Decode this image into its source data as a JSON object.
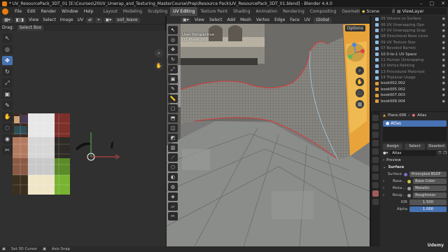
{
  "titlebar": {
    "title": "* UV_ResourcePack_3DT_01 [E:\\Courses\\20UV_Unwrap_and_Texturing_MasterCourse\\Prep\\Resource Pack\\UV_ResourcePack_3DT_01.blend] - Blender 4.4.0"
  },
  "menu": {
    "items": [
      "File",
      "Edit",
      "Render",
      "Window",
      "Help"
    ]
  },
  "workspaces": {
    "tabs": [
      "Layout",
      "Modeling",
      "Sculpting",
      "UV Editing",
      "Texture Paint",
      "Shading",
      "Animation",
      "Rendering",
      "Compositing",
      "Geometry Nodes",
      "Scripting"
    ],
    "active": "UV Editing"
  },
  "scene": {
    "label": "Scene"
  },
  "viewlayer": {
    "label": "ViewLayer"
  },
  "uv": {
    "header": {
      "view": "View",
      "select": "Select",
      "image": "Image",
      "uv": "UV",
      "image_name": "soil_leave"
    },
    "drag_label": "Drag:",
    "select_mode": "Select Box"
  },
  "viewport": {
    "menus": [
      "View",
      "Select",
      "Add",
      "Mesh",
      "Vertex",
      "Edge",
      "Face",
      "UV"
    ],
    "orientation": "Global",
    "options": "Options",
    "info_line1": "User Perspective",
    "info_line2": "(1) Plane.006"
  },
  "outliner": {
    "rows": [
      {
        "label": "05 Volume vs Surface",
        "kind": "col"
      },
      {
        "label": "06 UV Unwrapping Ope",
        "kind": "col"
      },
      {
        "label": "07 UV Unwrapping Grap",
        "kind": "col"
      },
      {
        "label": "08 Directional Nose Lines",
        "kind": "col"
      },
      {
        "label": "09 UV Texture Size",
        "kind": "col"
      },
      {
        "label": "07 Beveled Barrels",
        "kind": "col"
      },
      {
        "label": "10 0-to-1 UV Space",
        "kind": "col"
      },
      {
        "label": "11 Human Unwrapping",
        "kind": "col"
      },
      {
        "label": "12 Vertex Painting",
        "kind": "col"
      },
      {
        "label": "13 Procedural Materials",
        "kind": "col"
      },
      {
        "label": "14 Triplanar Usage",
        "kind": "col"
      },
      {
        "label": "book002.002",
        "kind": "mesh"
      },
      {
        "label": "book005.002",
        "kind": "mesh"
      },
      {
        "label": "book007.003",
        "kind": "mesh"
      },
      {
        "label": "book008.004",
        "kind": "mesh"
      }
    ]
  },
  "props": {
    "object": "Plane.006",
    "material_tab": "Atlas",
    "slot": "Atlas",
    "buttons": {
      "assign": "Assign",
      "select": "Select",
      "deselect": "Deselect"
    },
    "material_name": "Atlas",
    "preview": "Preview",
    "surface_header": "Surface",
    "surface_label": "Surface",
    "surface_value": "Principled BSDF",
    "rows": [
      {
        "label": "Base...",
        "value": "Base Color"
      },
      {
        "label": "Meta...",
        "value": "Metallic"
      },
      {
        "label": "Roug...",
        "value": "Roughness"
      }
    ],
    "ior_label": "IOR",
    "ior_value": "1.500",
    "alpha_label": "Alpha",
    "alpha_value": "1.000"
  },
  "status": {
    "left": "Set 3D Cursor",
    "mid": "Axis Snap"
  },
  "watermark": "Udemy"
}
